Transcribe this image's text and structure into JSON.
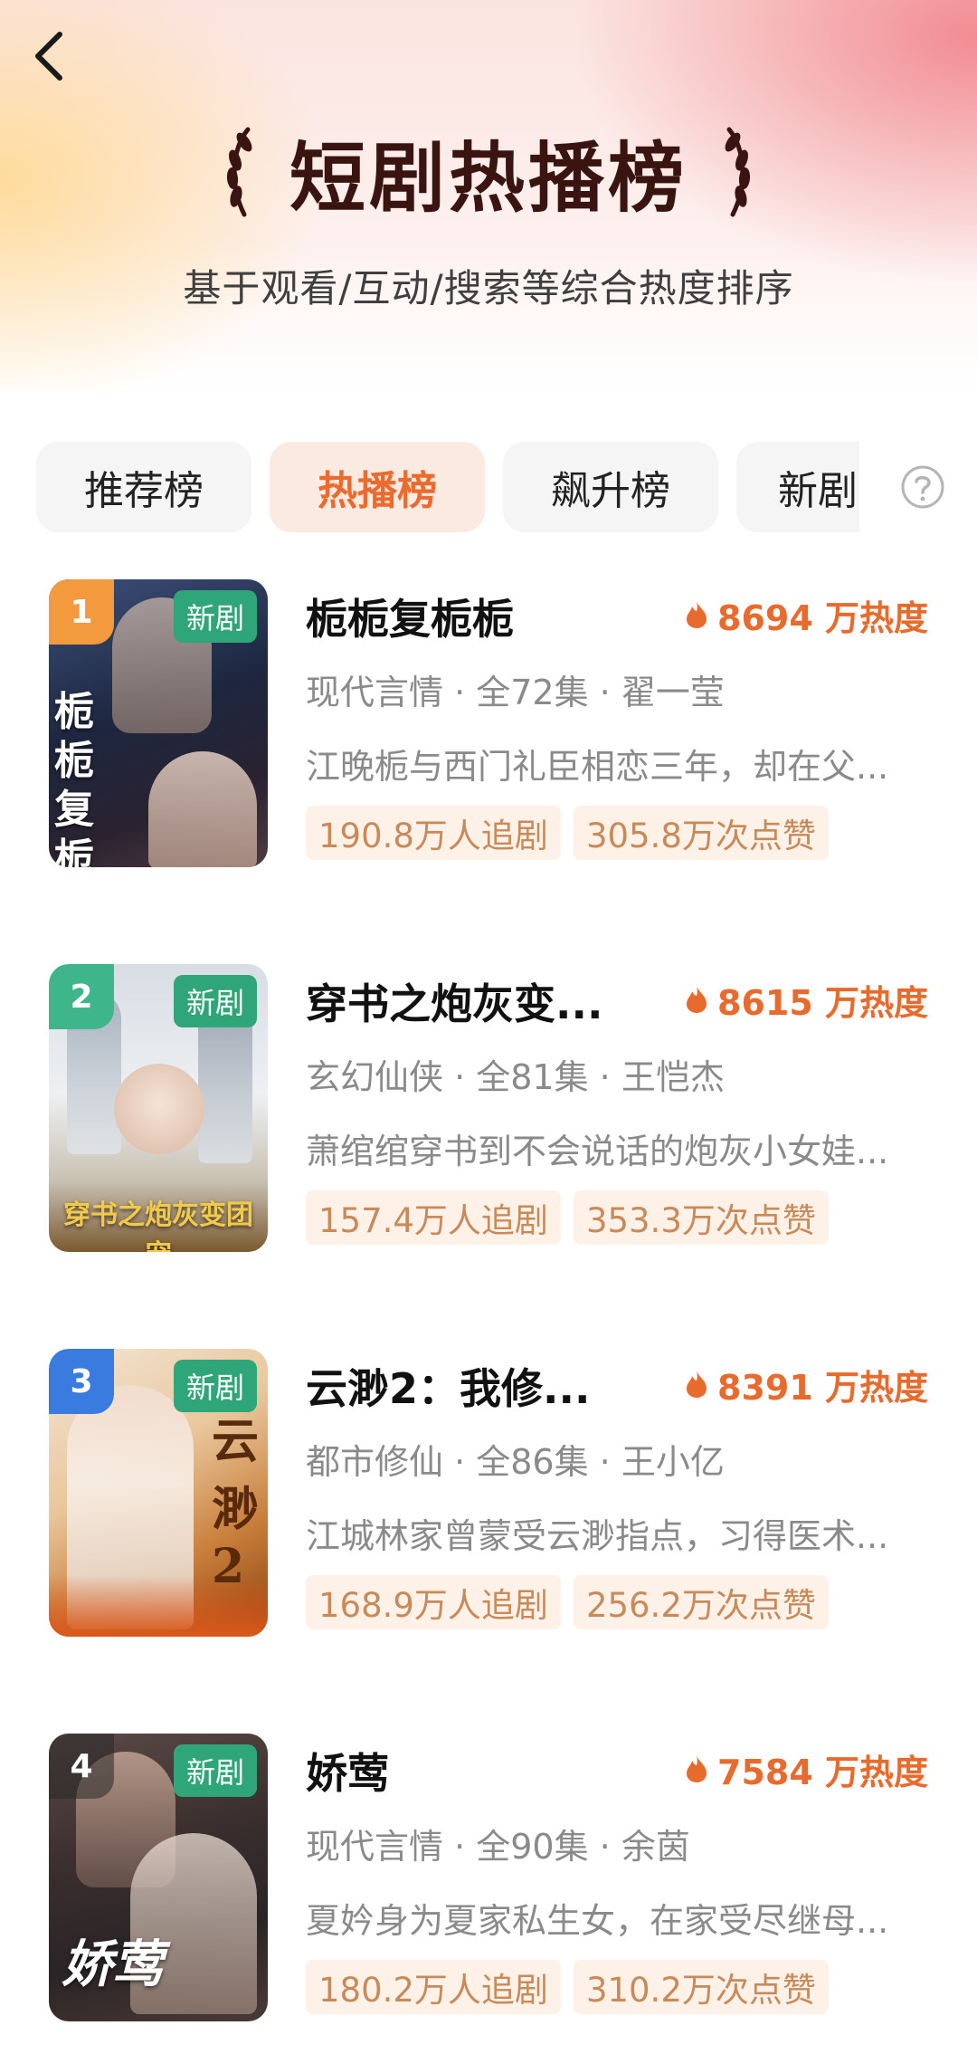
{
  "header": {
    "title": "短剧热播榜",
    "subtitle": "基于观看/互动/搜索等综合热度排序"
  },
  "tabs": [
    {
      "label": "推荐榜",
      "active": false
    },
    {
      "label": "热播榜",
      "active": true
    },
    {
      "label": "飙升榜",
      "active": false
    },
    {
      "label": "新剧",
      "active": false
    }
  ],
  "colors": {
    "accent": "#ea6b2d",
    "heat": "#e86a2c",
    "new_badge": "#2fa67a",
    "rank1": "#f29a3d",
    "rank2": "#3fb58c",
    "rank3": "#3a7be0",
    "rank4": "#5a5a5a"
  },
  "items": [
    {
      "rank": "1",
      "badge": "新剧",
      "poster_text": "栀栀复栀栀",
      "title": "栀栀复栀栀",
      "heat": "8694 万热度",
      "meta": "现代言情 · 全72集 · 翟一莹",
      "desc": "江晚栀与西门礼臣相恋三年，却在父...",
      "followers": "190.8万人追剧",
      "likes": "305.8万次点赞"
    },
    {
      "rank": "2",
      "badge": "新剧",
      "poster_text": "穿书之炮灰变团宠",
      "title": "穿书之炮灰变...",
      "heat": "8615 万热度",
      "meta": "玄幻仙侠 · 全81集 · 王恺杰",
      "desc": "萧绾绾穿书到不会说话的炮灰小女娃...",
      "followers": "157.4万人追剧",
      "likes": "353.3万次点赞"
    },
    {
      "rank": "3",
      "badge": "新剧",
      "poster_text": "云渺2",
      "title": "云渺2：我修...",
      "heat": "8391 万热度",
      "meta": "都市修仙 · 全86集 · 王小亿",
      "desc": "江城林家曾蒙受云渺指点，习得医术...",
      "followers": "168.9万人追剧",
      "likes": "256.2万次点赞"
    },
    {
      "rank": "4",
      "badge": "新剧",
      "poster_text": "娇莺",
      "title": "娇莺",
      "heat": "7584 万热度",
      "meta": "现代言情 · 全90集 · 余茵",
      "desc": "夏妗身为夏家私生女，在家受尽继母...",
      "followers": "180.2万人追剧",
      "likes": "310.2万次点赞"
    }
  ]
}
